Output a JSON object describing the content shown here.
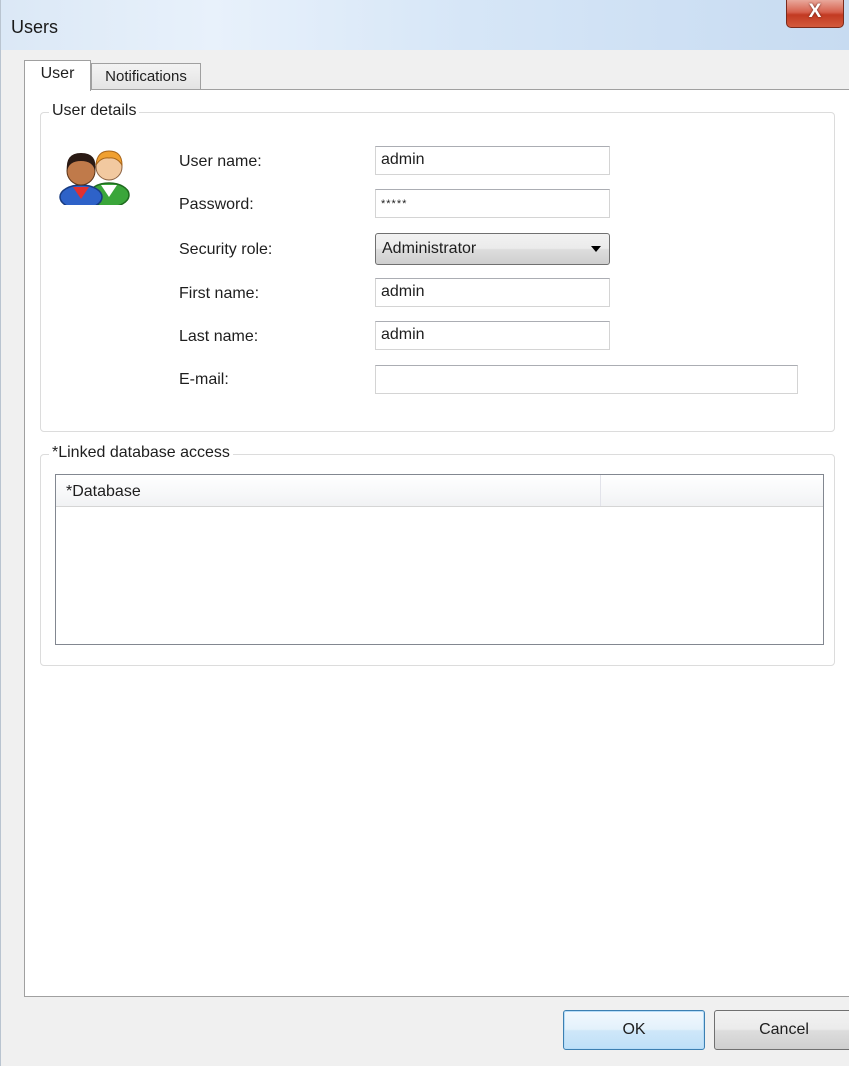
{
  "window": {
    "title": "Users",
    "close_glyph": "X"
  },
  "tabs": [
    {
      "label": "User",
      "active": true
    },
    {
      "label": "Notifications",
      "active": false
    }
  ],
  "user_details": {
    "group_title": "User details",
    "icon": "users-icon",
    "fields": {
      "username": {
        "label": "User name:",
        "value": "admin"
      },
      "password": {
        "label": "Password:",
        "value": "*****"
      },
      "security_role": {
        "label": "Security role:",
        "value": "Administrator"
      },
      "first_name": {
        "label": "First name:",
        "value": "admin"
      },
      "last_name": {
        "label": "Last name:",
        "value": "admin"
      },
      "email": {
        "label": "E-mail:",
        "value": ""
      }
    }
  },
  "linked_db": {
    "group_title": "*Linked database access",
    "columns": [
      "*Database",
      ""
    ],
    "rows": []
  },
  "buttons": {
    "ok": "OK",
    "cancel": "Cancel"
  },
  "colors": {
    "close_button": "#c23a22",
    "ok_button_border": "#3c7fb1",
    "titlebar": "#dbe8f6"
  }
}
